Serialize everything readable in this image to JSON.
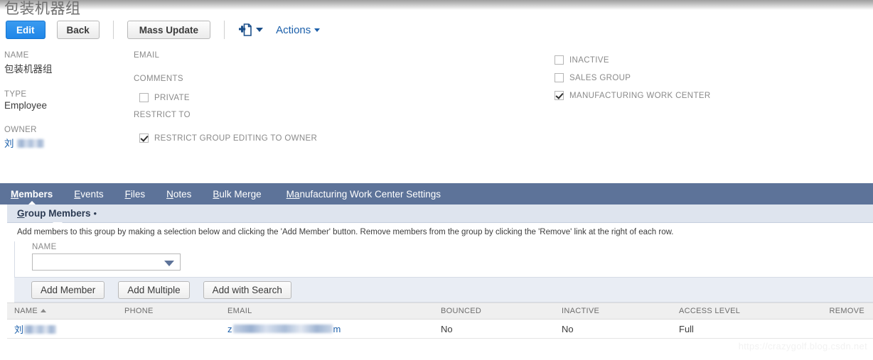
{
  "page": {
    "title": "包装机器组",
    "watermark": "https://crazygolf.blog.csdn.net"
  },
  "toolbar": {
    "edit_label": "Edit",
    "back_label": "Back",
    "mass_update_label": "Mass Update",
    "new_doc_icon": "add-document-icon",
    "actions_label": "Actions"
  },
  "details": {
    "name_label": "NAME",
    "name_value": "包装机器组",
    "type_label": "TYPE",
    "type_value": "Employee",
    "owner_label": "OWNER",
    "owner_value_prefix": "刘",
    "email_label": "EMAIL",
    "email_value": "",
    "comments_label": "COMMENTS",
    "comments_value": "",
    "private_label": "PRIVATE",
    "private_checked": false,
    "restrict_to_label": "RESTRICT TO",
    "restrict_editing_label": "RESTRICT GROUP EDITING TO OWNER",
    "restrict_editing_checked": true,
    "inactive_label": "INACTIVE",
    "inactive_checked": false,
    "sales_group_label": "SALES GROUP",
    "sales_group_checked": false,
    "mfg_work_center_label": "MANUFACTURING WORK CENTER",
    "mfg_work_center_checked": true
  },
  "tabs": [
    {
      "label": "Members",
      "accel": "M",
      "rest": "embers",
      "active": true
    },
    {
      "label": "Events",
      "accel": "E",
      "rest": "vents",
      "active": false
    },
    {
      "label": "Files",
      "accel": "F",
      "rest": "iles",
      "active": false
    },
    {
      "label": "Notes",
      "accel": "N",
      "rest": "otes",
      "active": false
    },
    {
      "label": "Bulk Merge",
      "accel": "B",
      "rest": "ulk Merge",
      "active": false
    },
    {
      "label": "Manufacturing Work Center Settings",
      "accel": "Ma",
      "rest": "nufacturing Work Center Settings",
      "active": false
    }
  ],
  "panel": {
    "title_accel": "G",
    "title_rest": "roup Members",
    "bullet": "•",
    "help_text": "Add members to this group by making a selection below and clicking the 'Add Member' button. Remove members from the group by clicking the 'Remove' link at the right of each row.",
    "select_label": "NAME",
    "select_value": "",
    "select_placeholder": "",
    "buttons": [
      "Add Member",
      "Add Multiple",
      "Add with Search"
    ]
  },
  "table": {
    "columns": [
      {
        "label": "NAME",
        "sorted": "asc"
      },
      {
        "label": "PHONE",
        "sorted": ""
      },
      {
        "label": "EMAIL",
        "sorted": ""
      },
      {
        "label": "BOUNCED",
        "sorted": ""
      },
      {
        "label": "INACTIVE",
        "sorted": ""
      },
      {
        "label": "ACCESS LEVEL",
        "sorted": ""
      },
      {
        "label": "REMOVE",
        "sorted": ""
      }
    ],
    "rows": [
      {
        "name": "刘",
        "name_redacted": true,
        "phone": "",
        "email_prefix": "z",
        "email_suffix": "m",
        "email_redacted": true,
        "bounced": "No",
        "inactive": "No",
        "access_level": "Full",
        "remove": ""
      }
    ]
  },
  "colors": {
    "primary_button": "#1f86e8",
    "tabbar": "#5d7399",
    "panel_header": "#dee4ee",
    "link": "#1b5faa"
  }
}
